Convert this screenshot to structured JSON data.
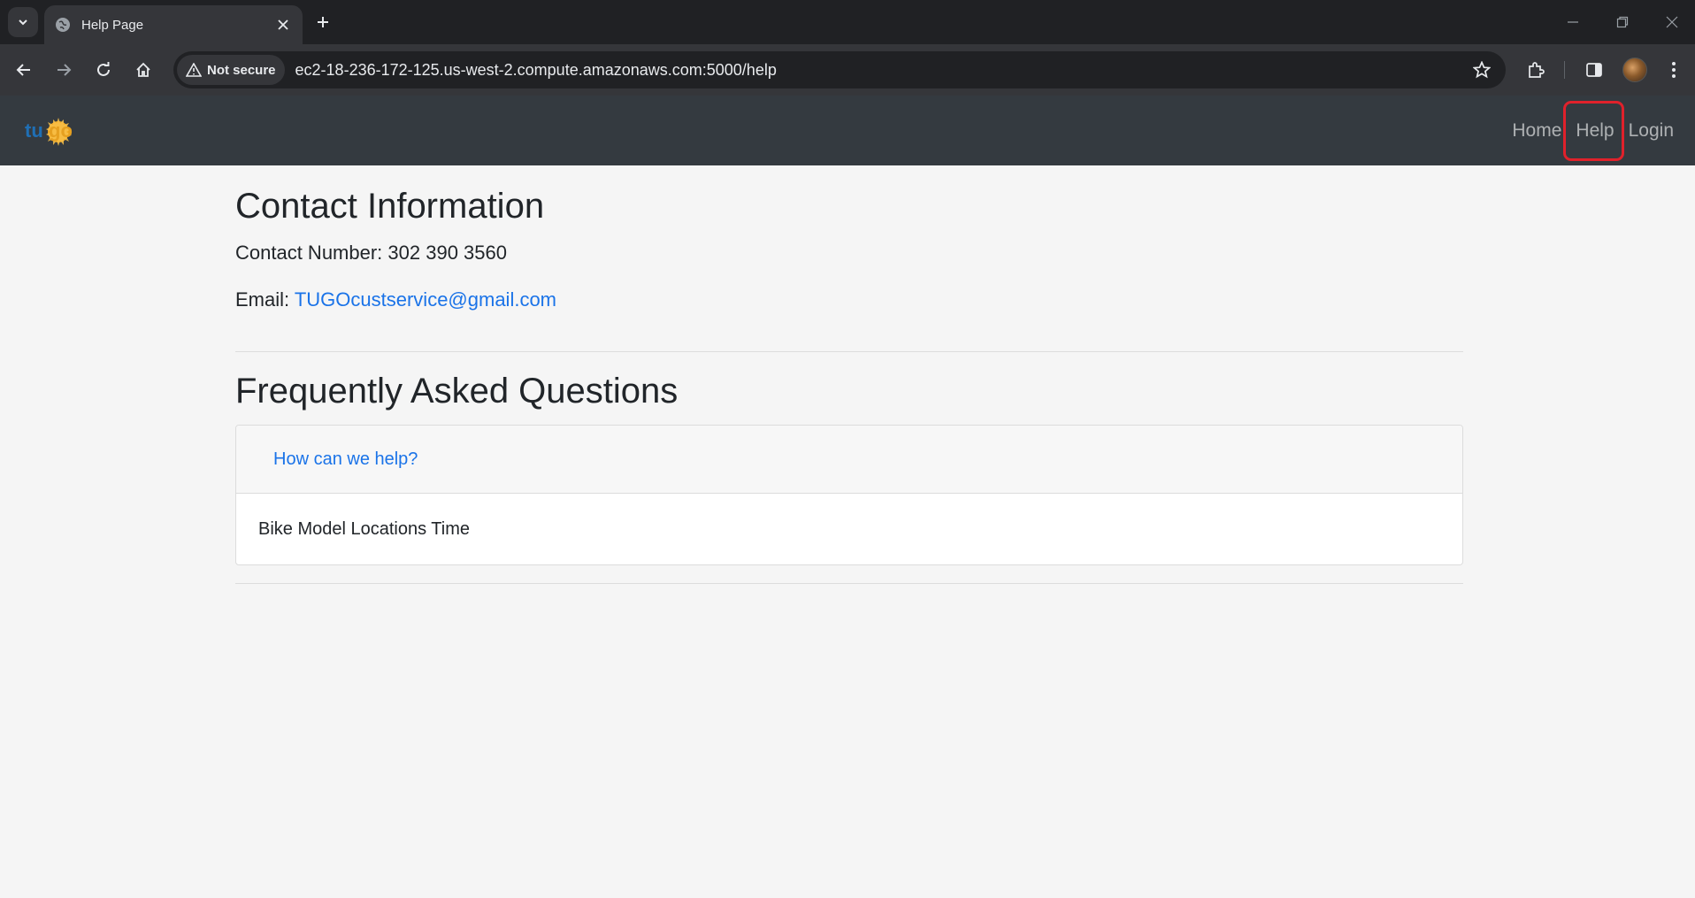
{
  "browser": {
    "tab": {
      "title": "Help Page"
    },
    "security_label": "Not secure",
    "url": "ec2-18-236-172-125.us-west-2.compute.amazonaws.com:5000/help"
  },
  "navbar": {
    "brand": "tugo",
    "links": [
      {
        "label": "Home"
      },
      {
        "label": "Help"
      },
      {
        "label": "Login"
      }
    ]
  },
  "contact": {
    "title": "Contact Information",
    "number_label": "Contact Number: 302 390 3560",
    "email_label": "Email: ",
    "email": "TUGOcustservice@gmail.com"
  },
  "faq": {
    "title": "Frequently Asked Questions",
    "card_header": "How can we help?",
    "card_body": "Bike Model Locations Time"
  },
  "colors": {
    "navbar_bg": "#343a40",
    "link": "#1a73e8",
    "highlight": "#e0212b"
  }
}
